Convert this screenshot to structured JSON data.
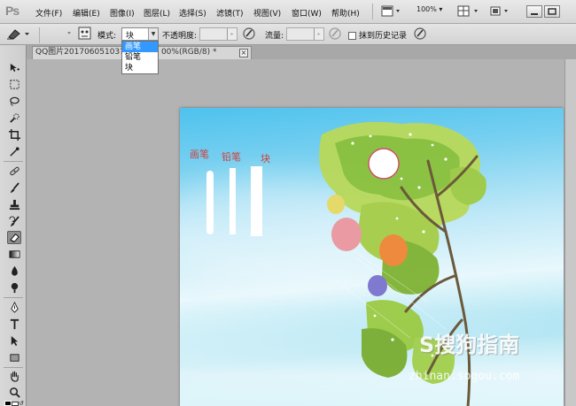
{
  "menubar": {
    "logo": "Ps",
    "items": [
      {
        "label": "文件(F)"
      },
      {
        "label": "编辑(E)"
      },
      {
        "label": "图像(I)"
      },
      {
        "label": "图层(L)"
      },
      {
        "label": "选择(S)"
      },
      {
        "label": "滤镜(T)"
      },
      {
        "label": "视图(V)"
      },
      {
        "label": "窗口(W)"
      },
      {
        "label": "帮助(H)"
      }
    ],
    "zoom": "100%"
  },
  "options": {
    "mode_label": "模式:",
    "mode_value": "块",
    "opacity_label": "不透明度:",
    "opacity_value": "",
    "flow_label": "流量:",
    "flow_value": "",
    "erase_history_label": "抹到历史记录",
    "erase_history_checked": false
  },
  "mode_dropdown": {
    "options": [
      {
        "label": "画笔",
        "selected": true
      },
      {
        "label": "铅笔",
        "selected": false
      },
      {
        "label": "块",
        "selected": false
      }
    ]
  },
  "document": {
    "tab_title_start": "QQ图片20170605103?",
    "tab_title_end": "00%(RGB/8) *",
    "close": "×"
  },
  "toolbar": {
    "active_tool": "eraser",
    "tools": [
      "move",
      "marquee",
      "lasso",
      "quick-select",
      "crop",
      "eyedropper",
      "spot-healing",
      "brush",
      "clone-stamp",
      "history-brush",
      "eraser",
      "gradient",
      "blur",
      "dodge",
      "pen",
      "type",
      "path-select",
      "shape",
      "hand",
      "zoom"
    ],
    "foreground_color": "#000000",
    "background_color": "#ffffff"
  },
  "canvas": {
    "labels": [
      "画笔",
      "铅笔",
      "块"
    ],
    "label_color": "#d0403c",
    "watermark_main": "S搜狗指南",
    "watermark_sub": "zhinan.sogou.com"
  }
}
